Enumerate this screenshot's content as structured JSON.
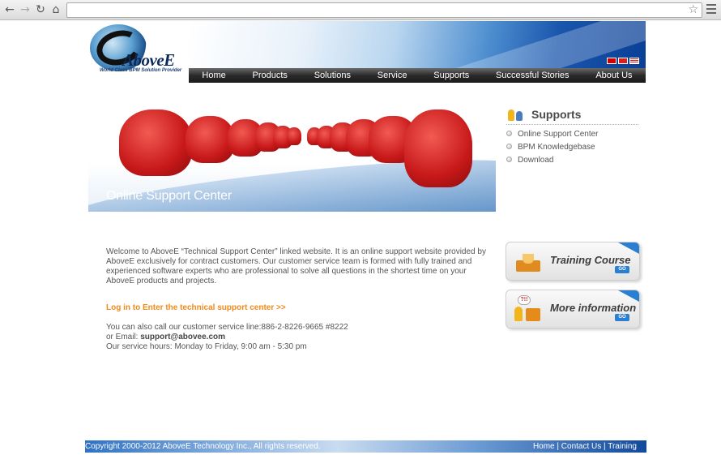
{
  "browser": {
    "back_icon": "arrow-left-icon",
    "forward_icon": "arrow-right-icon",
    "reload_icon": "reload-icon",
    "home_icon": "home-icon",
    "address_value": "",
    "star_icon": "star-icon",
    "menu_icon": "hamburger-menu-icon"
  },
  "header": {
    "logo_text": "AboveE",
    "logo_tagline": "World Class BPM Solution Provider",
    "flags": [
      "taiwan-flag",
      "china-flag",
      "us-flag"
    ],
    "nav": [
      "Home",
      "Products",
      "Solutions",
      "Service",
      "Supports",
      "Successful Stories",
      "About Us"
    ]
  },
  "hero": {
    "caption": "Online Support Center"
  },
  "sidebar": {
    "title": "Supports",
    "items": [
      "Online Support Center",
      "BPM Knowledgebase",
      "Download"
    ]
  },
  "promos": {
    "training_label": "Training Course",
    "training_go": "GO",
    "info_label": "More information",
    "info_go": "GO",
    "info_bubble": "?!!"
  },
  "main": {
    "intro": "Welcome to AboveE “Technical Support Center” linked website. It is an online support website provided by AboveE exclusively for contract customers. Our customer service team is formed with fully trained and experienced software experts who are professional to solve all questions in the shortest time on your AboveE products and projects.",
    "login_link": "Log in to Enter the technical support center >>",
    "phone_line": "You can also call our customer service line:886-2-8226-9665 #8222",
    "email_prefix": "or Email: ",
    "email": "support@abovee.com",
    "hours": "Our service hours: Monday to Friday, 9:00 am - 5:30 pm"
  },
  "footer": {
    "copyright": "Copyright 2000-2012 AboveE Technology Inc., All rights reserved.",
    "links": [
      "Home",
      "Contact Us",
      "Training"
    ],
    "separator": " | "
  },
  "colors": {
    "accent_orange": "#f08a1c",
    "nav_dark": "#1a1a1a",
    "footer_blue": "#2f72c4",
    "chair_red": "#c8191a"
  }
}
